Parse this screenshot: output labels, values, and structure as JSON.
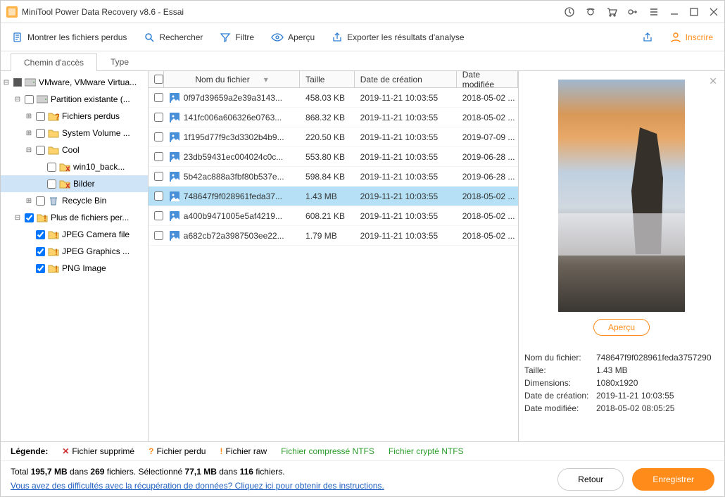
{
  "titlebar": {
    "title": "MiniTool Power Data Recovery v8.6 - Essai"
  },
  "toolbar": {
    "show_lost": "Montrer les fichiers perdus",
    "search": "Rechercher",
    "filter": "Filtre",
    "preview": "Aperçu",
    "export": "Exporter les résultats d'analyse",
    "register": "Inscrire"
  },
  "tabs": {
    "path": "Chemin d'accès",
    "type": "Type"
  },
  "tree": [
    {
      "indent": 0,
      "toggle": "−",
      "check": "half",
      "icon": "drive",
      "label": "VMware, VMware Virtua..."
    },
    {
      "indent": 1,
      "toggle": "−",
      "check": "off",
      "icon": "drive",
      "label": "Partition existante (..."
    },
    {
      "indent": 2,
      "toggle": "+",
      "check": "off",
      "icon": "folder-q",
      "label": "Fichiers perdus"
    },
    {
      "indent": 2,
      "toggle": "+",
      "check": "off",
      "icon": "folder",
      "label": "System Volume ..."
    },
    {
      "indent": 2,
      "toggle": "−",
      "check": "off",
      "icon": "folder",
      "label": "Cool"
    },
    {
      "indent": 3,
      "toggle": "",
      "check": "off",
      "icon": "folder-x",
      "label": "win10_back..."
    },
    {
      "indent": 3,
      "toggle": "",
      "check": "off",
      "icon": "folder-x",
      "label": "Bilder",
      "selected": true
    },
    {
      "indent": 2,
      "toggle": "+",
      "check": "off",
      "icon": "recycle",
      "label": "Recycle Bin"
    },
    {
      "indent": 1,
      "toggle": "−",
      "check": "on",
      "icon": "folder-e",
      "label": "Plus de fichiers per..."
    },
    {
      "indent": 2,
      "toggle": "",
      "check": "on",
      "icon": "folder-e",
      "label": "JPEG Camera file"
    },
    {
      "indent": 2,
      "toggle": "",
      "check": "on",
      "icon": "folder-e",
      "label": "JPEG Graphics ..."
    },
    {
      "indent": 2,
      "toggle": "",
      "check": "on",
      "icon": "folder-e",
      "label": "PNG Image"
    }
  ],
  "columns": {
    "name": "Nom du fichier",
    "size": "Taille",
    "created": "Date de création",
    "modified": "Date modifiée"
  },
  "files": [
    {
      "name": "0f97d39659a2e39a3143...",
      "size": "458.03 KB",
      "created": "2019-11-21 10:03:55",
      "modified": "2018-05-02 ..."
    },
    {
      "name": "141fc006a606326e0763...",
      "size": "868.32 KB",
      "created": "2019-11-21 10:03:55",
      "modified": "2018-05-02 ..."
    },
    {
      "name": "1f195d77f9c3d3302b4b9...",
      "size": "220.50 KB",
      "created": "2019-11-21 10:03:55",
      "modified": "2019-07-09 ..."
    },
    {
      "name": "23db59431ec004024c0c...",
      "size": "553.80 KB",
      "created": "2019-11-21 10:03:55",
      "modified": "2019-06-28 ..."
    },
    {
      "name": "5b42ac888a3fbf80b537e...",
      "size": "598.84 KB",
      "created": "2019-11-21 10:03:55",
      "modified": "2019-06-28 ..."
    },
    {
      "name": "748647f9f028961feda37...",
      "size": "1.43 MB",
      "created": "2019-11-21 10:03:55",
      "modified": "2018-05-02 ...",
      "selected": true
    },
    {
      "name": "a400b9471005e5af4219...",
      "size": "608.21 KB",
      "created": "2019-11-21 10:03:55",
      "modified": "2018-05-02 ..."
    },
    {
      "name": "a682cb72a3987503ee22...",
      "size": "1.79 MB",
      "created": "2019-11-21 10:03:55",
      "modified": "2018-05-02 ..."
    }
  ],
  "preview": {
    "button": "Aperçu",
    "meta": {
      "name_k": "Nom du fichier:",
      "name_v": "748647f9f028961feda3757290",
      "size_k": "Taille:",
      "size_v": "1.43 MB",
      "dim_k": "Dimensions:",
      "dim_v": "1080x1920",
      "created_k": "Date de création:",
      "created_v": "2019-11-21 10:03:55",
      "modified_k": "Date modifiée:",
      "modified_v": "2018-05-02 08:05:25"
    }
  },
  "legend": {
    "label": "Légende:",
    "deleted": "Fichier supprimé",
    "lost": "Fichier perdu",
    "raw": "Fichier raw",
    "compressed": "Fichier compressé NTFS",
    "encrypted": "Fichier crypté NTFS"
  },
  "footer": {
    "stats_pre": "Total ",
    "stats_total_size": "195,7 MB",
    "stats_mid1": " dans ",
    "stats_total_files": "269",
    "stats_mid2": " fichiers.  Sélectionné ",
    "stats_sel_size": "77,1 MB",
    "stats_mid3": " dans ",
    "stats_sel_files": "116",
    "stats_end": " fichiers.",
    "link": "Vous avez des difficultés avec la récupération de données? Cliquez ici pour obtenir des instructions.",
    "back": "Retour",
    "save": "Enregistrer"
  }
}
